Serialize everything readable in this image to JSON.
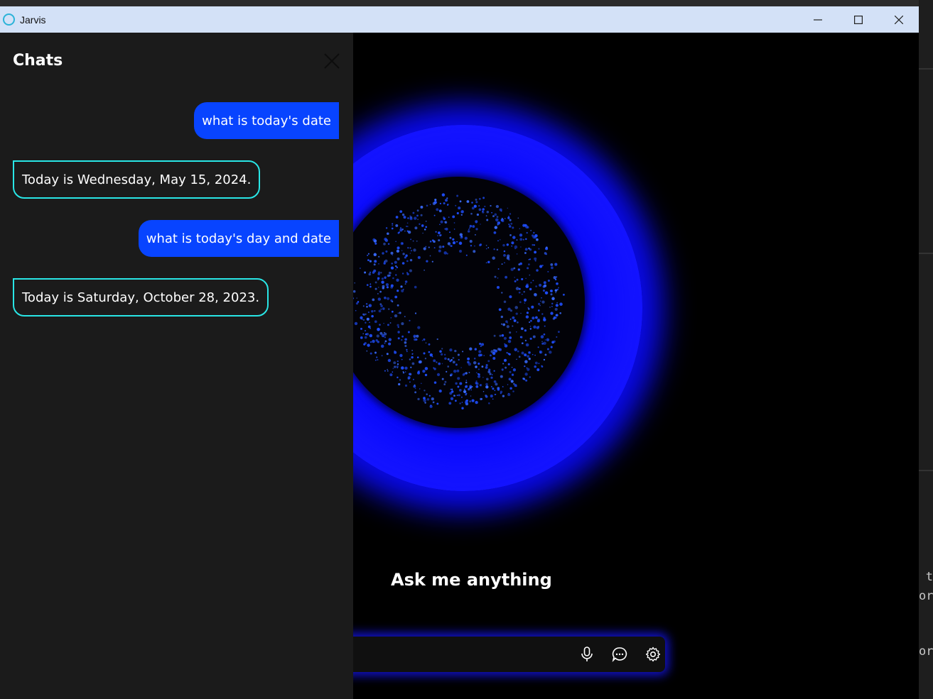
{
  "window": {
    "title": "Jarvis",
    "controls": [
      "minimize",
      "maximize",
      "close"
    ]
  },
  "sidebar": {
    "title": "Chats",
    "messages": [
      {
        "role": "user",
        "text": "what is today's date"
      },
      {
        "role": "assistant",
        "text": "Today is Wednesday, May 15, 2024."
      },
      {
        "role": "user",
        "text": "what is today's day and date"
      },
      {
        "role": "assistant",
        "text": "Today is Saturday, October 28, 2023."
      }
    ]
  },
  "main": {
    "prompt": "Ask me anything",
    "input": {
      "value": "",
      "placeholder": ""
    },
    "icons": [
      "microphone-icon",
      "chat-icon",
      "settings-icon"
    ]
  },
  "background": {
    "code_fragments": [
      "t",
      "or",
      "or"
    ]
  },
  "colors": {
    "titlebar": "#d3e1f7",
    "user_bubble": "#0844ff",
    "assistant_border": "#29e6e6",
    "sidebar_bg": "#1b1b1b",
    "orb_glow": "#0a0aff"
  }
}
